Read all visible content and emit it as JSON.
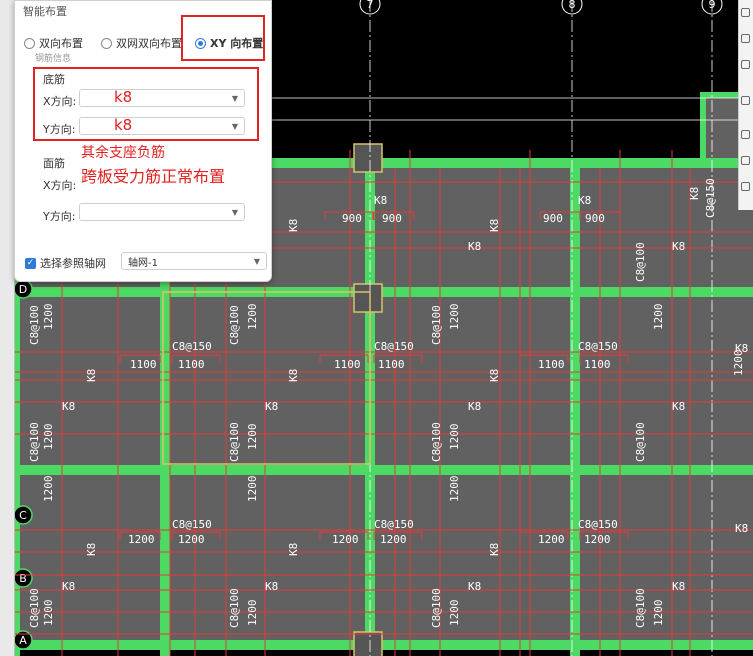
{
  "panel": {
    "section_title": "智能布置",
    "layout_options": [
      {
        "label": "双向布置",
        "selected": false
      },
      {
        "label": "双网双向布置",
        "selected": false
      },
      {
        "label": "XY 向布置",
        "selected": true
      }
    ],
    "subsection_partial": "钢筋信息",
    "bottom_group": {
      "label": "底筋",
      "x": {
        "label": "X方向:",
        "value": "k8"
      },
      "y": {
        "label": "Y方向:",
        "value": "k8"
      }
    },
    "top_group": {
      "label": "面筋",
      "x": {
        "label": "X方向:",
        "value": ""
      },
      "y": {
        "label": "Y方向:",
        "value": ""
      }
    },
    "annotation_1": "其余支座负筋",
    "annotation_2": "跨板受力筋正常布置",
    "axis_ref": {
      "checkbox_label": "选择参照轴网",
      "checked": true,
      "value": "轴网-1"
    }
  },
  "drawing": {
    "axis_top": [
      "7",
      "8",
      "9"
    ],
    "axis_left": [
      "D",
      "C",
      "B",
      "A"
    ],
    "slab_label": "K8",
    "dist_labels": [
      "C8@150",
      "C8@100"
    ],
    "neg_lengths": [
      "900",
      "1100",
      "1200"
    ],
    "colors": {
      "background": "#000000",
      "slab": "#616161",
      "beam": "#4cd964",
      "rebar": "#e23a3a",
      "grid": "#ffffff",
      "selection": "#d9c36a",
      "annotation": "#e02020"
    }
  }
}
